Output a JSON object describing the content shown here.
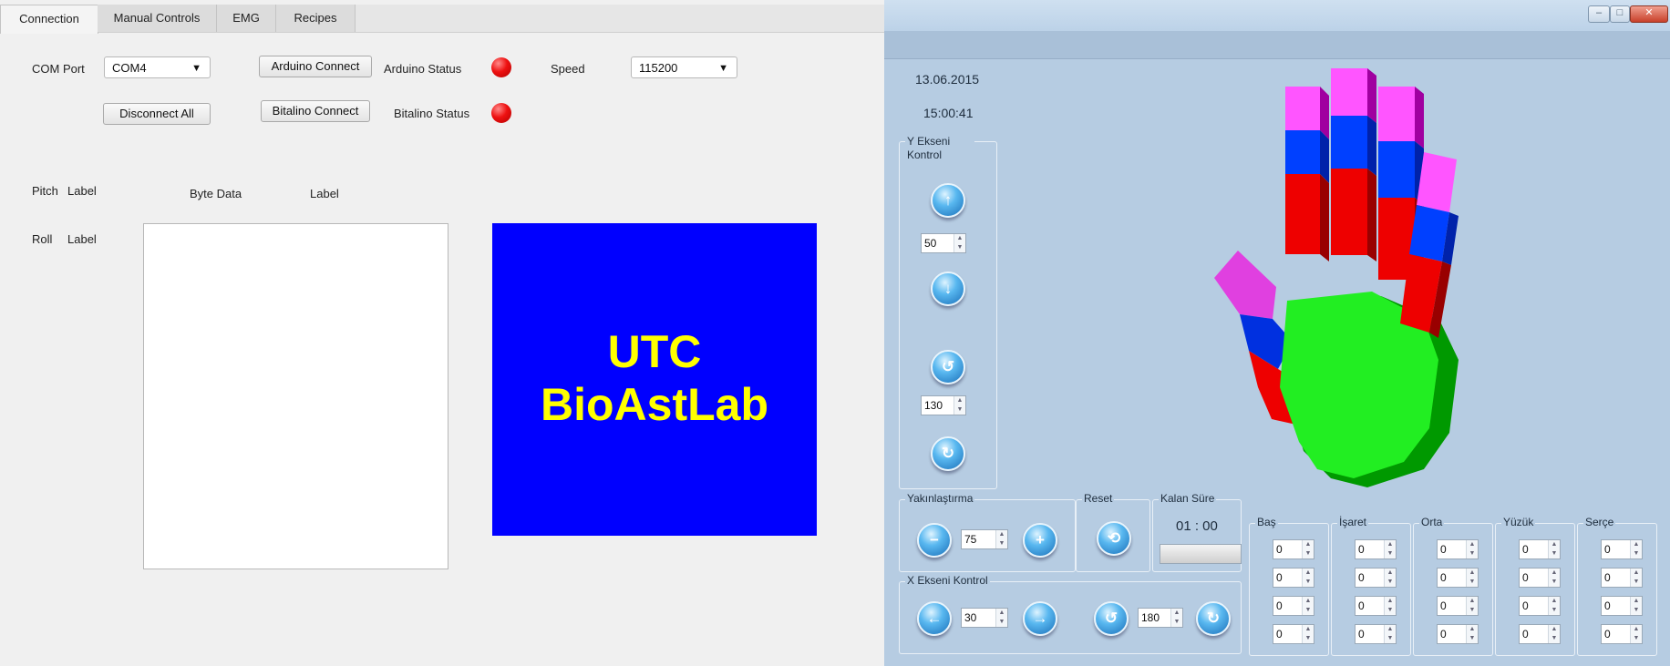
{
  "left_window": {
    "tabs": [
      "Connection",
      "Manual Controls",
      "EMG",
      "Recipes"
    ],
    "com_port": {
      "label": "COM Port",
      "value": "COM4"
    },
    "arduino_connect": "Arduino Connect",
    "arduino_status": "Arduino Status",
    "speed": {
      "label": "Speed",
      "value": "115200"
    },
    "disconnect_all": "Disconnect All",
    "bitalino_connect": "Bitalino Connect",
    "bitalino_status": "Bitalino Status",
    "pitch": {
      "label": "Pitch",
      "value": "Label"
    },
    "roll": {
      "label": "Roll",
      "value": "Label"
    },
    "byte_data": {
      "label": "Byte Data",
      "value": "Label"
    },
    "logo": {
      "line1": "UTC",
      "line2": "BioAstLab"
    },
    "colors": {
      "logo_bg": "#0000ff",
      "logo_text": "#ffff00",
      "led": "#ee1111"
    }
  },
  "right_window": {
    "date": "13.06.2015",
    "time": "15:00:41",
    "window_buttons": [
      "minimize",
      "maximize",
      "close"
    ],
    "y_axis": {
      "title": "Y Ekseni Kontrol",
      "value1": "50",
      "value2": "130"
    },
    "zoom": {
      "title": "Yakınlaştırma",
      "value": "75"
    },
    "reset": {
      "title": "Reset"
    },
    "remaining": {
      "title": "Kalan Süre",
      "value": "01 : 00"
    },
    "x_axis": {
      "title": "X Ekseni Kontrol",
      "value1": "30",
      "value2": "180"
    },
    "fingers": [
      {
        "name": "Baş",
        "values": [
          "0",
          "0",
          "0",
          "0"
        ]
      },
      {
        "name": "İşaret",
        "values": [
          "0",
          "0",
          "0",
          "0"
        ]
      },
      {
        "name": "Orta",
        "values": [
          "0",
          "0",
          "0",
          "0"
        ]
      },
      {
        "name": "Yüzük",
        "values": [
          "0",
          "0",
          "0",
          "0"
        ]
      },
      {
        "name": "Serçe",
        "values": [
          "0",
          "0",
          "0",
          "0"
        ]
      }
    ],
    "colors": {
      "background": "#b6cce2",
      "palm": "#00ff00",
      "finger_base": "#ff0000",
      "finger_mid": "#0044ff",
      "finger_tip": "#ff55ff"
    }
  }
}
